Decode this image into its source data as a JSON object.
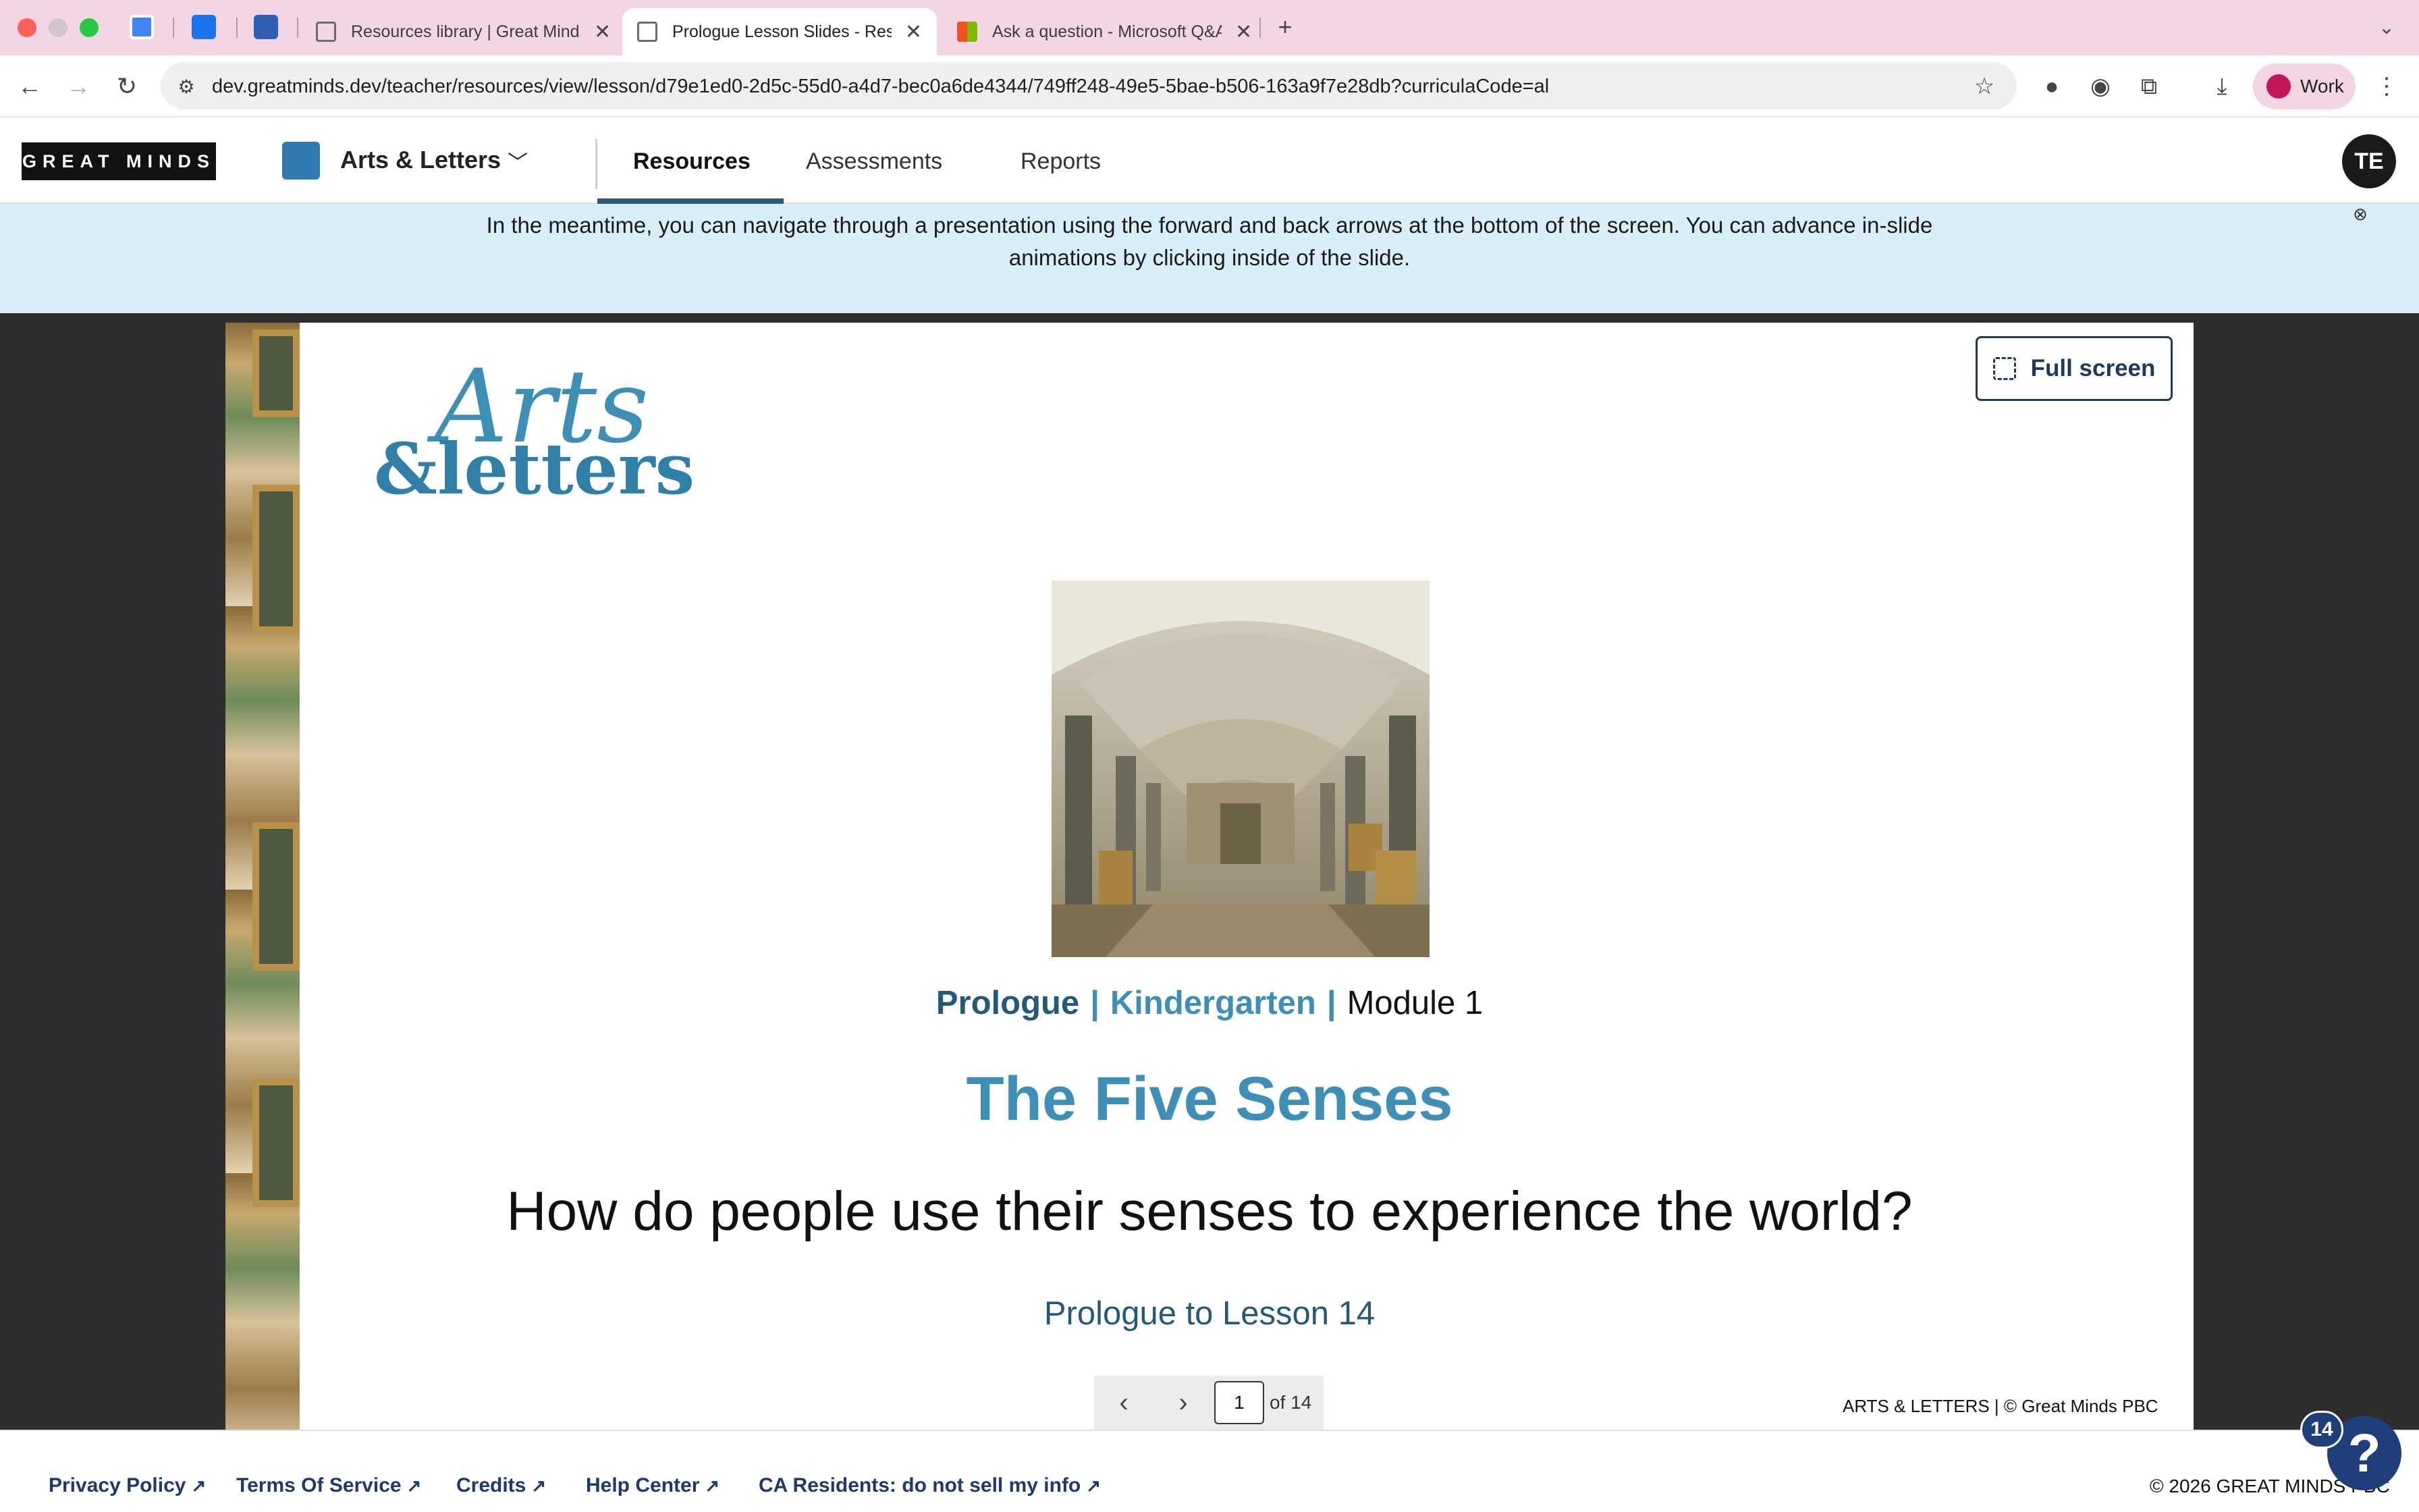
{
  "browser": {
    "tabs": [
      {
        "title": "Resources library | Great Minds",
        "active": false
      },
      {
        "title": "Prologue Lesson Slides - Resources",
        "active": true
      },
      {
        "title": "Ask a question - Microsoft Q&A",
        "active": false
      }
    ],
    "pinned_tab_icons": [
      "calendar-icon",
      "calendar-grid-icon",
      "app-icon"
    ],
    "url": "dev.greatminds.dev/teacher/resources/view/lesson/d79e1ed0-2d5c-55d0-a4d7-bec0a6de4344/749ff248-49e5-5bae-b506-163a9f7e28db?curriculaCode=al",
    "profile_label": "Work"
  },
  "header": {
    "logo_text": "GREAT MINDS",
    "product_name": "Arts & Letters",
    "nav": [
      {
        "label": "Resources",
        "active": true
      },
      {
        "label": "Assessments",
        "active": false
      },
      {
        "label": "Reports",
        "active": false
      }
    ],
    "avatar_initials": "TE"
  },
  "banner": {
    "text": "In the meantime, you can navigate through a presentation using the forward and back arrows at the bottom of the screen. You can advance in-slide animations by clicking inside of the slide."
  },
  "slide": {
    "fullscreen_label": "Full screen",
    "logo": {
      "line1": "Arts",
      "line2": "&letters"
    },
    "subtitle": {
      "prologue": "Prologue",
      "separator": "|",
      "grade": "Kindergarten",
      "module": "Module 1"
    },
    "title": "The Five Senses",
    "question": "How do people use their senses to experience the world?",
    "lesson": "Prologue to Lesson 14",
    "copyright": "ARTS & LETTERS  |  © Great Minds PBC"
  },
  "pager": {
    "current_page": "1",
    "of_label": "of 14"
  },
  "footer": {
    "links": [
      "Privacy Policy",
      "Terms Of Service",
      "Credits",
      "Help Center",
      "CA Residents: do not sell my info"
    ],
    "copyright": "© 2026 GREAT MINDS PBC"
  },
  "help": {
    "badge": "14",
    "symbol": "?"
  },
  "colors": {
    "tabbar": "#f2d6e6",
    "banner": "#d8eef8",
    "brand_blue": "#3e8fb5",
    "brand_dark": "#245a78",
    "nav_underline": "#2b5876",
    "footer_link": "#1f3a6a",
    "help_button": "#1f3f7a"
  }
}
